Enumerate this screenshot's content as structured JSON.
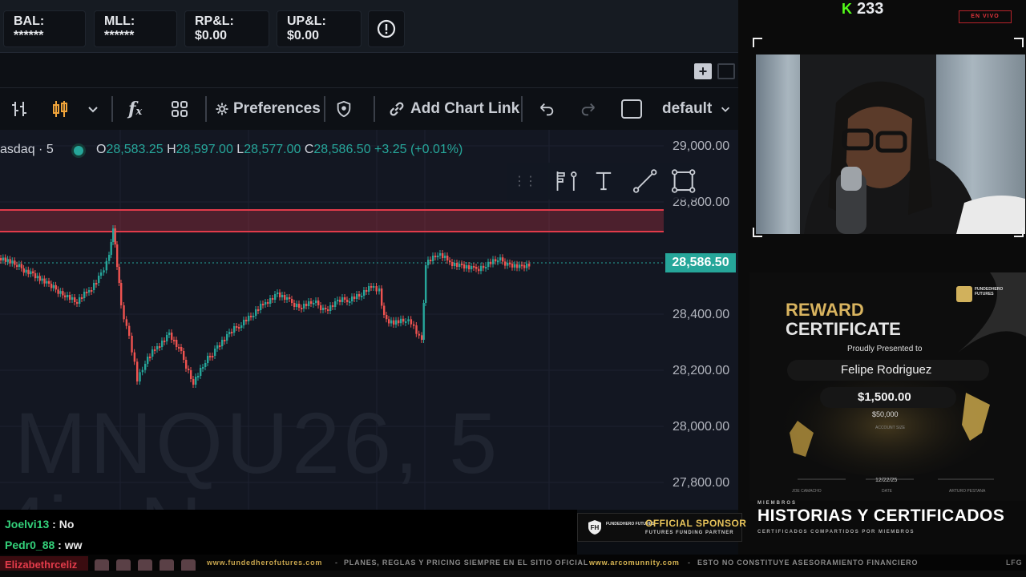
{
  "account_bar": {
    "balance": "BAL: ******",
    "mll": "MLL: ******",
    "rpl": "RP&L: $0.00",
    "upl": "UP&L: $0.00"
  },
  "toolbar": {
    "preferences": "Preferences",
    "add_chart_link": "Add Chart Link",
    "layout": "default"
  },
  "chart": {
    "symbol": "asdaq · 5",
    "ohlc": {
      "open_label": "O",
      "open": "28,583.25",
      "high_label": "H",
      "high": "28,597.00",
      "low_label": "L",
      "low": "28,577.00",
      "close_label": "C",
      "close": "28,586.50",
      "change": "+3.25 (+0.01%)"
    },
    "price_axis": [
      "29,000.00",
      "28,800.00",
      "28,400.00",
      "28,200.00",
      "28,000.00",
      "27,800.00"
    ],
    "current_price": "28,586.50",
    "watermark_symbol": "MNQU26, 5",
    "colors": {
      "up": "#26a69a",
      "down": "#ef5350",
      "zone": "#e23b4a"
    }
  },
  "stream": {
    "viewers": "233",
    "live_badge": "EN VIVO"
  },
  "certificate": {
    "title_line1": "REWARD",
    "title_line2": "CERTIFICATE",
    "presented": "Proudly Presented to",
    "name": "Felipe Rodriguez",
    "payout": "$1,500.00",
    "account": "$50,000",
    "account_label": "ACCOUNT SIZE",
    "date": "12/22/25",
    "date_label": "DATE",
    "signer1": "JOE CAMACHO",
    "signer2": "ARTURO PESTANA",
    "brand": "FUNDEDHERO FUTURES"
  },
  "section": {
    "small_label": "MIEMBROS",
    "title": "HISTORIAS Y CERTIFICADOS",
    "subtitle": "CERTIFICADOS COMPARTIDOS POR MIEMBROS"
  },
  "chat": [
    {
      "user": "Joelvi13",
      "msg": ": No"
    },
    {
      "user": "Pedr0_88",
      "msg": ": ww"
    },
    {
      "user": "Elizabethrceliz",
      "msg": ""
    }
  ],
  "sponsor": {
    "brand": "FUNDEDHERO FUTURES",
    "title": "OFFICIAL SPONSOR",
    "subtitle": "FUTURES FUNDING PARTNER"
  },
  "ticker": {
    "site1": "www.fundedherofutures.com",
    "msg1": "PLANES, REGLAS Y PRICING SIEMPRE EN EL SITIO OFICIAL",
    "site2": "www.arcomunnity.com",
    "msg2": "ESTO NO CONSTITUYE ASESORAMIENTO FINANCIERO",
    "tag": "LFG"
  }
}
